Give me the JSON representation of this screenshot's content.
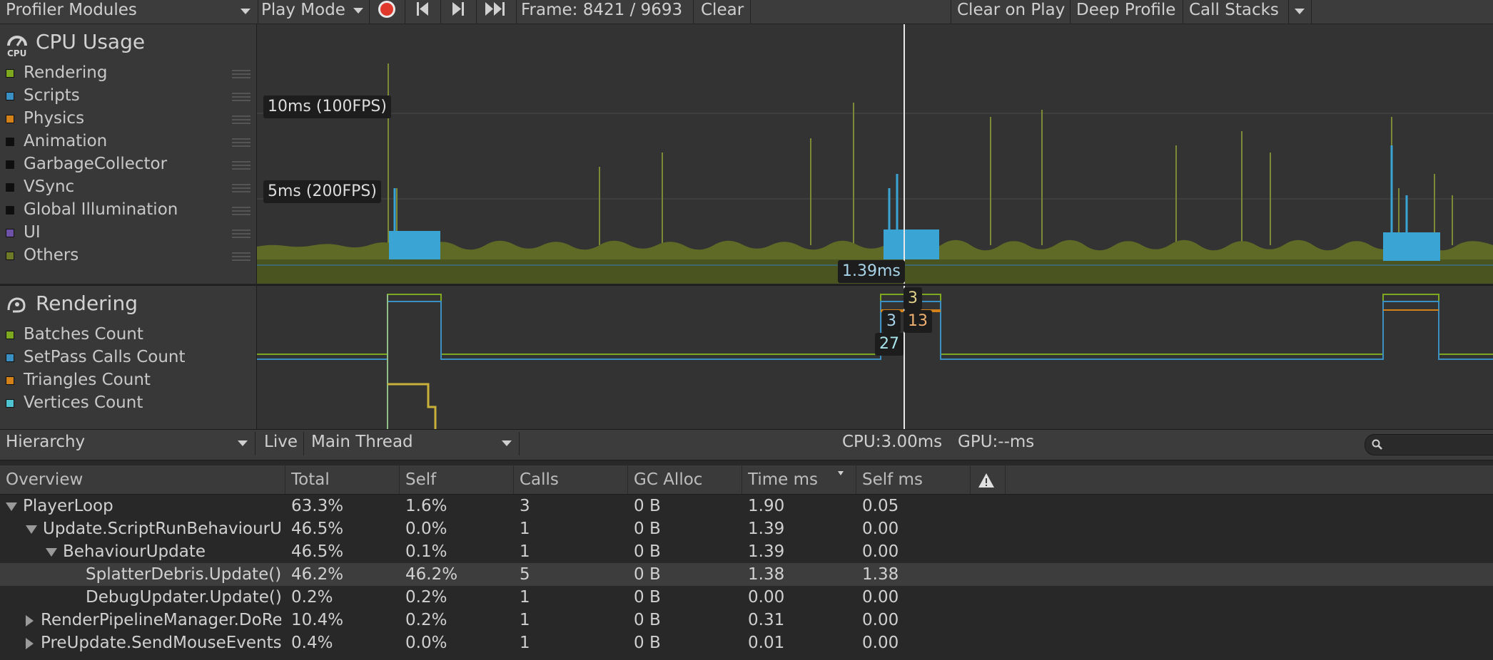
{
  "toolbar": {
    "profiler_modules": "Profiler Modules",
    "play_mode": "Play Mode",
    "frame_label": "Frame: 8421 / 9693",
    "clear": "Clear",
    "clear_on_play": "Clear on Play",
    "deep_profile": "Deep Profile",
    "call_stacks": "Call Stacks"
  },
  "cpu_module": {
    "title": "CPU Usage",
    "icon_text": "CPU",
    "legend": [
      {
        "label": "Rendering",
        "color": "#7fa821"
      },
      {
        "label": "Scripts",
        "color": "#3a8fc3"
      },
      {
        "label": "Physics",
        "color": "#d38119"
      },
      {
        "label": "Animation",
        "color": "#0e0e0e"
      },
      {
        "label": "GarbageCollector",
        "color": "#0e0e0e"
      },
      {
        "label": "VSync",
        "color": "#0e0e0e"
      },
      {
        "label": "Global Illumination",
        "color": "#0e0e0e"
      },
      {
        "label": "UI",
        "color": "#6e52a8"
      },
      {
        "label": "Others",
        "color": "#6f7a29"
      }
    ],
    "threshold_10ms": "10ms (100FPS)",
    "threshold_5ms": "5ms (200FPS)",
    "selected_value": "1.39ms"
  },
  "rendering_module": {
    "title": "Rendering",
    "legend": [
      {
        "label": "Batches Count",
        "color": "#7fa821"
      },
      {
        "label": "SetPass Calls Count",
        "color": "#3a8fc3"
      },
      {
        "label": "Triangles Count",
        "color": "#d38119"
      },
      {
        "label": "Vertices Count",
        "color": "#4fc3d0"
      }
    ],
    "value_labels": {
      "batches": "3",
      "setpass": "3",
      "triangles": "13",
      "vertices": "27"
    }
  },
  "hierarchy_bar": {
    "view": "Hierarchy",
    "live": "Live",
    "thread": "Main Thread",
    "cpu": "CPU:3.00ms",
    "gpu": "GPU:--ms",
    "search_placeholder": ""
  },
  "table": {
    "columns": [
      "Overview",
      "Total",
      "Self",
      "Calls",
      "GC Alloc",
      "Time ms",
      "Self ms"
    ],
    "rows": [
      {
        "name": "PlayerLoop",
        "total": "63.3%",
        "self": "1.6%",
        "calls": "3",
        "gc": "0 B",
        "time": "1.90",
        "selfms": "0.05",
        "depth": 0,
        "expander": "open",
        "selected": false
      },
      {
        "name": "Update.ScriptRunBehaviourU",
        "total": "46.5%",
        "self": "0.0%",
        "calls": "1",
        "gc": "0 B",
        "time": "1.39",
        "selfms": "0.00",
        "depth": 1,
        "expander": "open",
        "selected": false
      },
      {
        "name": "BehaviourUpdate",
        "total": "46.5%",
        "self": "0.1%",
        "calls": "1",
        "gc": "0 B",
        "time": "1.39",
        "selfms": "0.00",
        "depth": 2,
        "expander": "open",
        "selected": false
      },
      {
        "name": "SplatterDebris.Update() [",
        "total": "46.2%",
        "self": "46.2%",
        "calls": "5",
        "gc": "0 B",
        "time": "1.38",
        "selfms": "1.38",
        "depth": 3,
        "expander": "none",
        "selected": true
      },
      {
        "name": "DebugUpdater.Update()",
        "total": "0.2%",
        "self": "0.2%",
        "calls": "1",
        "gc": "0 B",
        "time": "0.00",
        "selfms": "0.00",
        "depth": 3,
        "expander": "none",
        "selected": false
      },
      {
        "name": "RenderPipelineManager.DoRe",
        "total": "10.4%",
        "self": "0.2%",
        "calls": "1",
        "gc": "0 B",
        "time": "0.31",
        "selfms": "0.00",
        "depth": 1,
        "expander": "closed",
        "selected": false
      },
      {
        "name": "PreUpdate.SendMouseEvents",
        "total": "0.4%",
        "self": "0.0%",
        "calls": "1",
        "gc": "0 B",
        "time": "0.01",
        "selfms": "0.00",
        "depth": 1,
        "expander": "closed",
        "selected": false
      }
    ]
  }
}
